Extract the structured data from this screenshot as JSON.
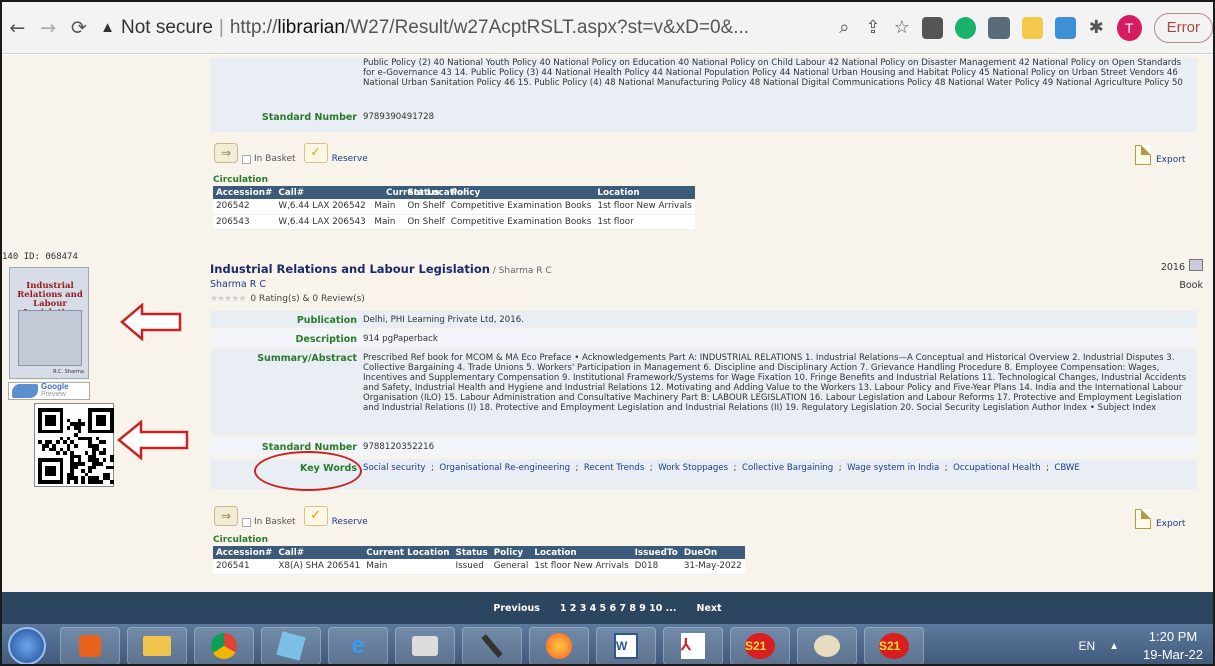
{
  "browser": {
    "security_label": "Not secure",
    "url_prefix": "http://",
    "url_host": "librarian",
    "url_path": "/W27/Result/w27AcptRSLT.aspx?st=v&xD=0&...",
    "profile_initial": "T",
    "error_label": "Error"
  },
  "record1": {
    "policy_text": "Public Policy (2) 40 National Youth Policy 40 National Policy on Education 40 National Policy on Child Labour 42 National Policy on Disaster Management 42 National Policy on Open Standards for e-Governance 43 14. Public Policy (3) 44 National Health Policy 44 National Population Policy 44 National Urban Housing and Habitat Policy 45 National Policy on Urban Street Vendors 46 National Urban Sanitation Policy 46 15. Public Policy (4) 48 National Manufacturing Policy 48 National Digital Communications Policy 48 National Water Policy 49 National Agriculture Policy 50",
    "std_label": "Standard Number",
    "std_value": "9789390491728",
    "in_basket": "In Basket",
    "reserve": "Reserve",
    "export": "Export",
    "circulation": "Circulation",
    "columns": [
      "Accession#",
      "Call#",
      "Current Location",
      "Status",
      "Policy",
      "Location"
    ],
    "rows": [
      [
        "206542",
        "W,6.44 LAX 206542",
        "Main",
        "On Shelf",
        "Competitive Examination Books",
        "1st floor New Arrivals"
      ],
      [
        "206543",
        "W,6.44 LAX 206543",
        "Main",
        "On Shelf",
        "Competitive Examination Books",
        "1st floor"
      ]
    ]
  },
  "record2": {
    "number": "140",
    "id": "ID:  068474",
    "title": "Industrial Relations and Labour Legislation",
    "title_author": " / Sharma R C",
    "author": "Sharma R C",
    "rating": "0 Rating(s) & 0 Review(s)",
    "year": "2016",
    "type": "Book",
    "cover_title": "Industrial Relations and Labour Legislation",
    "cover_author": "R.C. Sharma",
    "google_label": "Google",
    "google_sub": "Preview",
    "fields": [
      {
        "label": "Publication",
        "value": "Delhi, PHI Learning Private Ltd, 2016."
      },
      {
        "label": "Description",
        "value": "914 pgPaperback"
      },
      {
        "label": "Summary/Abstract",
        "value": "Prescribed Ref book for MCOM & MA Eco Preface • Acknowledgements Part A: INDUSTRIAL RELATIONS 1. Industrial Relations—A Conceptual and Historical Overview 2. Industrial Disputes 3. Collective Bargaining 4. Trade Unions 5. Workers' Participation in Management 6. Discipline and Disciplinary Action 7. Grievance Handling Procedure 8. Employee Compensation: Wages, Incentives and Supplementary Compensation 9. Institutional Framework/Systems for Wage Fixation 10. Fringe Benefits and Industrial Relations 11. Technological Changes, Industrial Accidents and Safety, Industrial Health and Hygiene and Industrial Relations 12. Motivating and Adding Value to the Workers 13. Labour Policy and Five-Year Plans 14. India and the International Labour Organisation (ILO) 15. Labour Administration and Consultative Machinery Part B: LABOUR LEGISLATION 16. Labour Legislation and Labour Reforms 17. Protective and Employment Legislation and Industrial Relations (I) 18. Protective and Employment Legislation and Industrial Relations (II) 19. Regulatory Legislation 20. Social Security Legislation Author Index • Subject Index"
      },
      {
        "label": "Standard Number",
        "value": "9788120352216"
      }
    ],
    "keywords_label": "Key Words",
    "keywords": [
      "Social security",
      "Organisational Re-engineering",
      "Recent Trends",
      "Work Stoppages",
      "Collective Bargaining",
      "Wage system in India",
      "Occupational Health",
      "CBWE"
    ],
    "in_basket": "In Basket",
    "reserve": "Reserve",
    "export": "Export",
    "circulation": "Circulation",
    "columns": [
      "Accession#",
      "Call#",
      "Current Location",
      "Status",
      "Policy",
      "Location",
      "IssuedTo",
      "DueOn"
    ],
    "rows": [
      [
        "206541",
        "X8(A) SHA 206541",
        "Main",
        "Issued",
        "General",
        "1st floor New Arrivals",
        "D018",
        "31-May-2022"
      ]
    ]
  },
  "pager": {
    "previous": "Previous",
    "pages": "1 2 3 4 5 6 7 8 9 10 ...",
    "next": "Next"
  },
  "taskbar": {
    "lang": "EN",
    "time": "1:20 PM",
    "date": "19-Mar-22"
  },
  "colors": {
    "header_bg": "#3c5a7a",
    "label_green": "#2a7a2a",
    "annotation_red": "#cc2222",
    "pager_bg": "#2d4660"
  }
}
